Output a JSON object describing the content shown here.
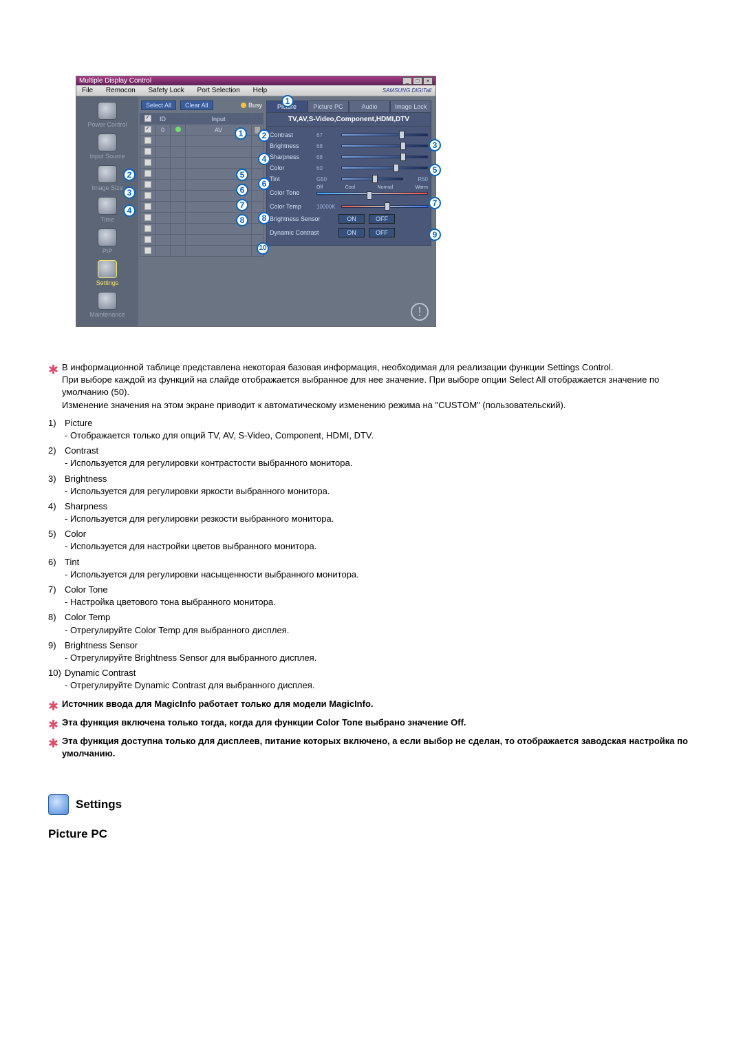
{
  "window": {
    "title": "Multiple Display Control",
    "menus": [
      "File",
      "Remocon",
      "Safety Lock",
      "Port Selection",
      "Help"
    ],
    "brand": "SAMSUNG DIGITall"
  },
  "sidebar": {
    "items": [
      {
        "label": "Power Control"
      },
      {
        "label": "Input Source"
      },
      {
        "label": "Image Size"
      },
      {
        "label": "Time"
      },
      {
        "label": "PIP"
      },
      {
        "label": "Settings"
      },
      {
        "label": "Maintenance"
      }
    ]
  },
  "toolbar": {
    "select_all": "Select All",
    "clear_all": "Clear All",
    "busy": "Busy"
  },
  "table": {
    "headers": [
      "",
      "ID",
      "",
      "Input"
    ],
    "rows": [
      {
        "chk": true,
        "id": "0",
        "led": true,
        "input": "AV"
      },
      {
        "chk": false,
        "id": "",
        "led": false,
        "input": ""
      },
      {
        "chk": false,
        "id": "",
        "led": false,
        "input": ""
      },
      {
        "chk": false,
        "id": "",
        "led": false,
        "input": ""
      },
      {
        "chk": false,
        "id": "",
        "led": false,
        "input": ""
      },
      {
        "chk": false,
        "id": "",
        "led": false,
        "input": ""
      },
      {
        "chk": false,
        "id": "",
        "led": false,
        "input": ""
      },
      {
        "chk": false,
        "id": "",
        "led": false,
        "input": ""
      },
      {
        "chk": false,
        "id": "",
        "led": false,
        "input": ""
      },
      {
        "chk": false,
        "id": "",
        "led": false,
        "input": ""
      },
      {
        "chk": false,
        "id": "",
        "led": false,
        "input": ""
      },
      {
        "chk": false,
        "id": "",
        "led": false,
        "input": ""
      }
    ]
  },
  "panel": {
    "tabs": [
      "Picture",
      "Picture PC",
      "Audio",
      "Image Lock"
    ],
    "mode": "TV,AV,S-Video,Component,HDMI,DTV",
    "rows": {
      "contrast": {
        "label": "Contrast",
        "value": "67"
      },
      "brightness": {
        "label": "Brightness",
        "value": "68"
      },
      "sharpness": {
        "label": "Sharpness",
        "value": "68"
      },
      "color": {
        "label": "Color",
        "value": "60"
      },
      "tint": {
        "label": "Tint",
        "left": "G50",
        "right": "R50"
      },
      "colortone": {
        "label": "Color Tone",
        "opts": [
          "Off",
          "Cool",
          "Normal",
          "Warm"
        ]
      },
      "colortemp": {
        "label": "Color Temp",
        "value": "10000K"
      },
      "bsensor": {
        "label": "Brightness Sensor",
        "on": "ON",
        "off": "OFF"
      },
      "dcontrast": {
        "label": "Dynamic Contrast",
        "on": "ON",
        "off": "OFF"
      }
    }
  },
  "callouts_side": {
    "2": "2",
    "3": "3",
    "4": "4"
  },
  "desc": {
    "intro": [
      "В информационной таблице представлена некоторая базовая информация, необходимая для реализации функции Settings Control.",
      "При выборе каждой из функций на слайде отображается выбранное для нее значение. При выборе опции Select All отображается значение по умолчанию (50).",
      "Изменение значения на этом экране приводит к автоматическому изменению режима на \"CUSTOM\" (пользовательский)."
    ],
    "items": [
      {
        "n": "1)",
        "t": "Picture",
        "d": "- Отображается только для опций TV, AV, S-Video, Component, HDMI, DTV."
      },
      {
        "n": "2)",
        "t": "Contrast",
        "d": "- Используется для регулировки контрастости выбранного монитора."
      },
      {
        "n": "3)",
        "t": "Brightness",
        "d": "- Используется для регулировки яркости выбранного монитора."
      },
      {
        "n": "4)",
        "t": "Sharpness",
        "d": "- Используется для регулировки резкости выбранного монитора."
      },
      {
        "n": "5)",
        "t": "Color",
        "d": "- Используется для настройки цветов выбранного монитора."
      },
      {
        "n": "6)",
        "t": "Tint",
        "d": "- Используется для регулировки насыщенности выбранного монитора."
      },
      {
        "n": "7)",
        "t": "Color Tone",
        "d": "- Настройка цветового тона выбранного монитора."
      },
      {
        "n": "8)",
        "t": "Color Temp",
        "d": "- Отрегулируйте Color Temp для выбранного дисплея."
      },
      {
        "n": "9)",
        "t": "Brightness Sensor",
        "d": "- Отрегулируйте Brightness Sensor для выбранного дисплея."
      },
      {
        "n": "10)",
        "t": "Dynamic Contrast",
        "d": "- Отрегулируйте Dynamic Contrast для выбранного дисплея."
      }
    ],
    "notes": [
      "Источник ввода для MagicInfo работает только для модели MagicInfo.",
      "Эта функция включена только тогда, когда для функции Color Tone выбрано значение Off.",
      "Эта функция доступна только для дисплеев, питание которых включено, а если выбор не сделан, то отображается заводская настройка по умолчанию."
    ]
  },
  "section": {
    "heading": "Settings",
    "sub": "Picture PC"
  }
}
